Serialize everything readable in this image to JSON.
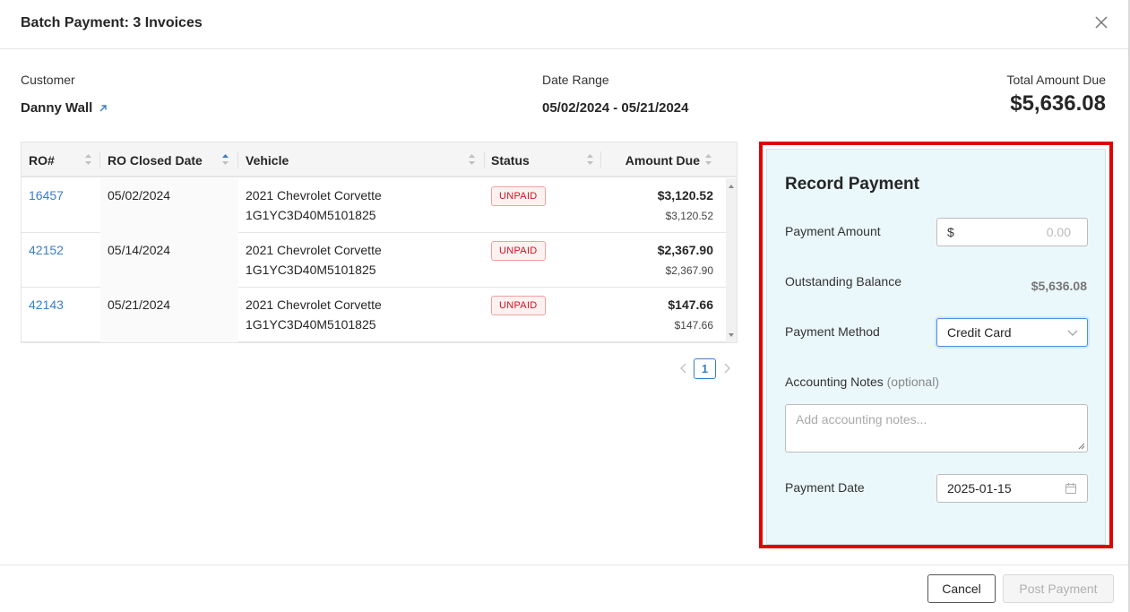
{
  "modal": {
    "title": "Batch Payment: 3 Invoices"
  },
  "summary": {
    "customer_label": "Customer",
    "customer_name": "Danny Wall",
    "date_range_label": "Date Range",
    "date_range": "05/02/2024 - 05/21/2024",
    "total_label": "Total Amount Due",
    "total_value": "$5,636.08"
  },
  "table": {
    "columns": [
      "RO#",
      "RO Closed Date",
      "Vehicle",
      "Status",
      "Amount Due"
    ],
    "sorted_column": "RO Closed Date",
    "rows": [
      {
        "ro": "16457",
        "closed": "05/02/2024",
        "vehicle": "2021 Chevrolet Corvette",
        "vin": "1G1YC3D40M5101825",
        "status": "UNPAID",
        "amount": "$3,120.52",
        "amount_sub": "$3,120.52"
      },
      {
        "ro": "42152",
        "closed": "05/14/2024",
        "vehicle": "2021 Chevrolet Corvette",
        "vin": "1G1YC3D40M5101825",
        "status": "UNPAID",
        "amount": "$2,367.90",
        "amount_sub": "$2,367.90"
      },
      {
        "ro": "42143",
        "closed": "05/21/2024",
        "vehicle": "2021 Chevrolet Corvette",
        "vin": "1G1YC3D40M5101825",
        "status": "UNPAID",
        "amount": "$147.66",
        "amount_sub": "$147.66"
      }
    ]
  },
  "pagination": {
    "current_page": "1"
  },
  "record_payment": {
    "title": "Record Payment",
    "amount_label": "Payment Amount",
    "amount_prefix": "$",
    "amount_placeholder": "0.00",
    "balance_label": "Outstanding Balance",
    "balance_value": "$5,636.08",
    "method_label": "Payment Method",
    "method_value": "Credit Card",
    "notes_label": "Accounting Notes",
    "notes_optional": "(optional)",
    "notes_placeholder": "Add accounting notes...",
    "date_label": "Payment Date",
    "date_value": "2025-01-15"
  },
  "footer": {
    "cancel_label": "Cancel",
    "post_label": "Post Payment"
  },
  "colors": {
    "link": "#3a7ec6",
    "highlight_border": "#e00000",
    "panel_bg": "#eaf7fb",
    "unpaid": "#cf1322"
  }
}
